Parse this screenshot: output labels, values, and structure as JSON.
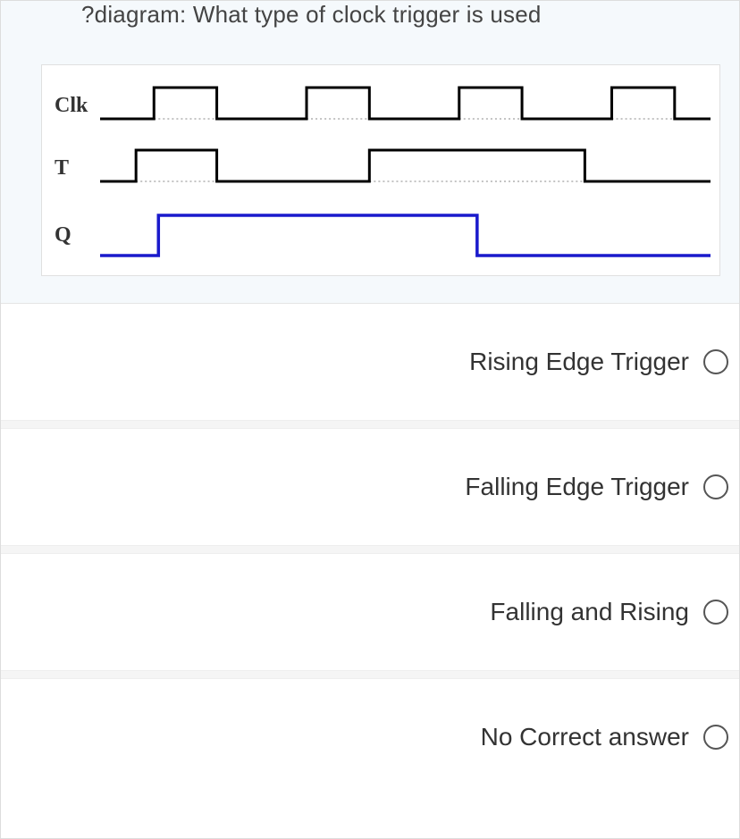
{
  "question": {
    "text": "?diagram: What type of clock trigger is used"
  },
  "signals": {
    "clk_label": "Clk",
    "t_label": "T",
    "q_label": "Q"
  },
  "chart_data": {
    "type": "timing-diagram",
    "description": "Digital timing diagram with Clk, T, and Q signals",
    "time_axis": [
      0,
      1,
      2,
      3,
      4,
      5,
      6,
      7,
      8,
      9,
      10,
      11,
      12,
      13,
      14,
      15
    ],
    "signals": [
      {
        "name": "Clk",
        "color": "#000000",
        "baseline_dotted": true,
        "values": [
          0,
          0,
          1,
          1,
          0,
          0,
          1,
          1,
          0,
          0,
          1,
          1,
          0,
          0,
          1,
          1,
          0,
          0
        ]
      },
      {
        "name": "T",
        "color": "#000000",
        "baseline_dotted": true,
        "values": [
          0,
          1,
          1,
          0,
          0,
          0,
          0,
          0,
          1,
          1,
          1,
          1,
          1,
          1,
          0,
          0,
          0,
          0
        ]
      },
      {
        "name": "Q",
        "color": "#1a1acc",
        "baseline_dotted": false,
        "values": [
          0,
          0,
          1,
          1,
          1,
          1,
          1,
          1,
          1,
          1,
          1,
          0,
          0,
          0,
          0,
          0,
          0,
          0
        ]
      }
    ]
  },
  "options": [
    {
      "label": "Rising Edge Trigger"
    },
    {
      "label": "Falling Edge Trigger"
    },
    {
      "label": "Falling and Rising"
    },
    {
      "label": "No Correct answer"
    }
  ]
}
